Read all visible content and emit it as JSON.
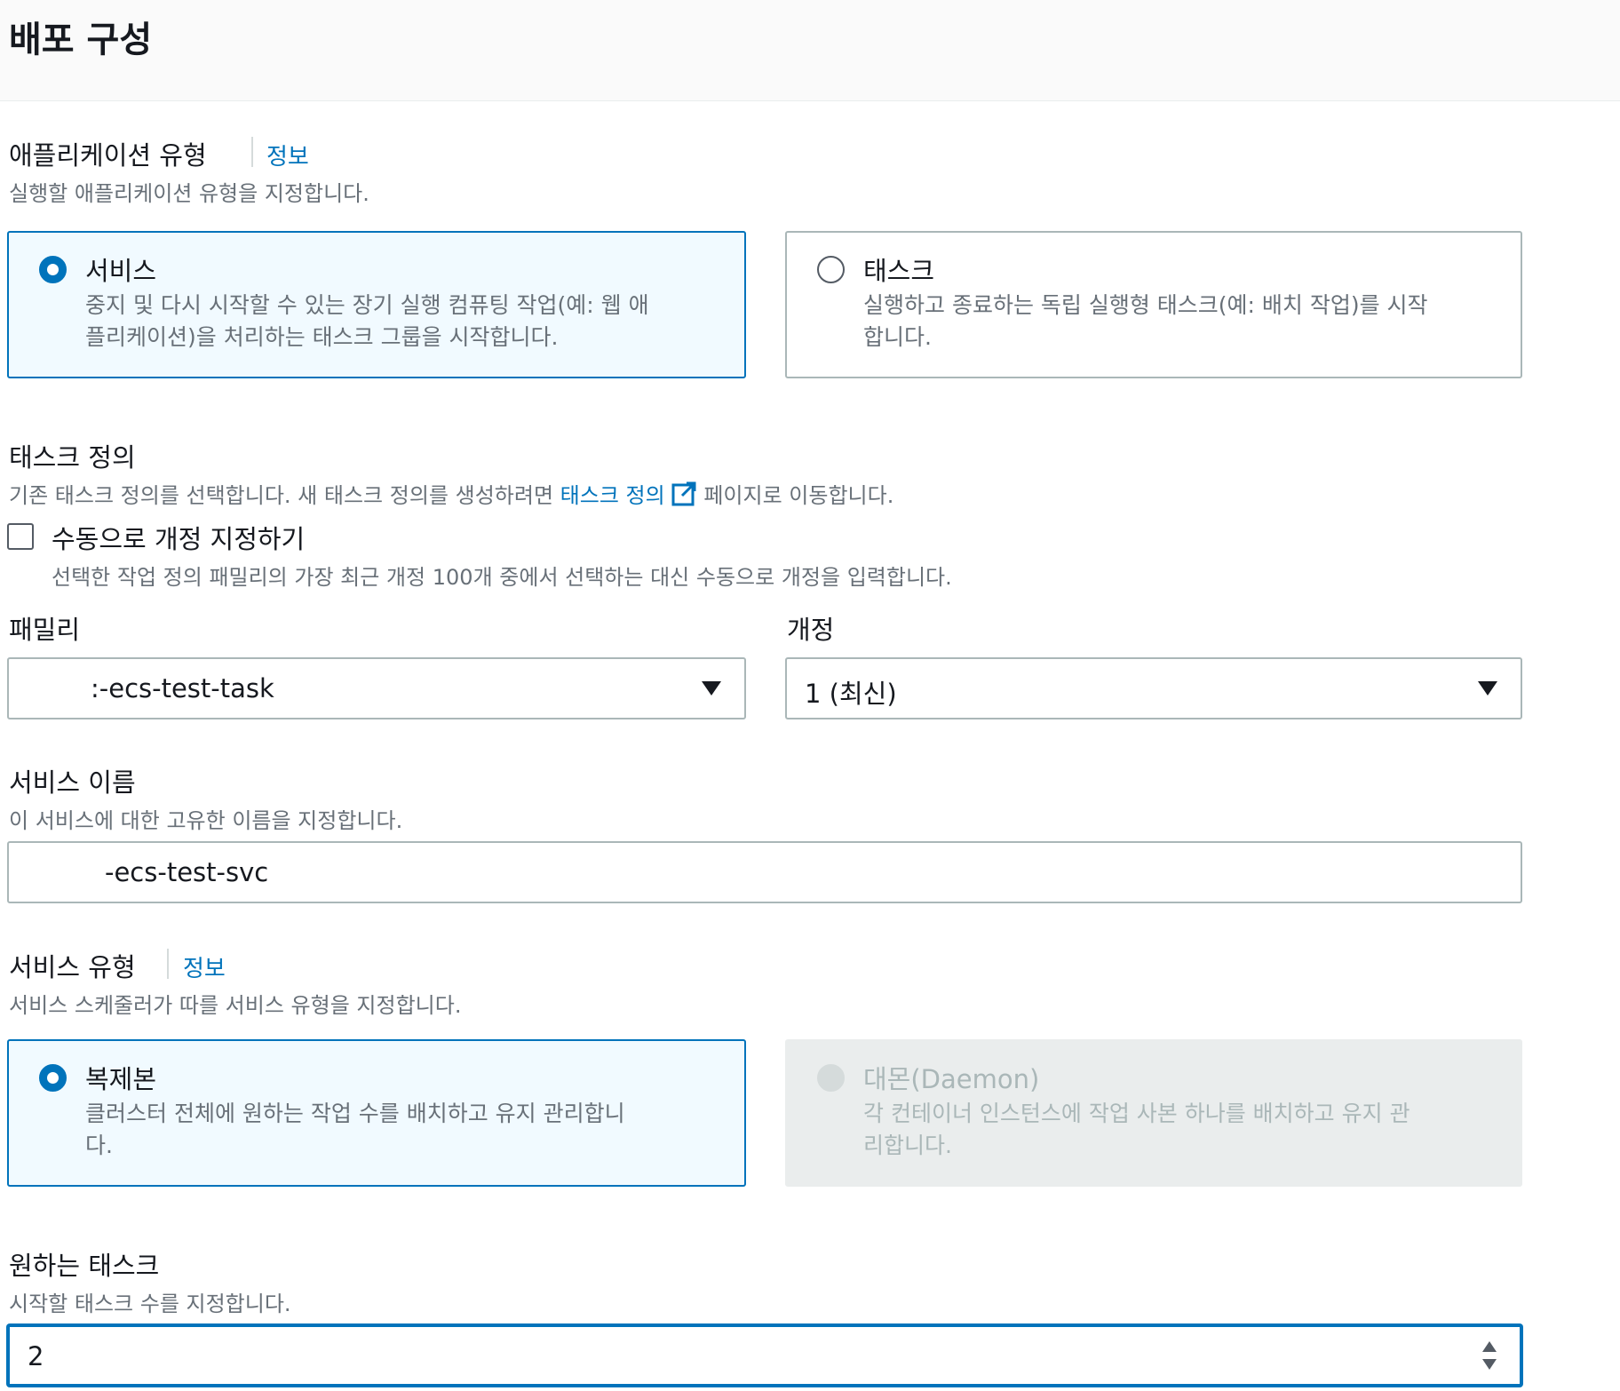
{
  "header": {
    "title": "배포 구성"
  },
  "application_type": {
    "label": "애플리케이션 유형",
    "info_link": "정보",
    "description": "실행할 애플리케이션 유형을 지정합니다.",
    "options": [
      {
        "title": "서비스",
        "description_line1": "중지 및 다시 시작할 수 있는 장기 실행 컴퓨팅 작업(예: 웹 애",
        "description_line2": "플리케이션)을 처리하는 태스크 그룹을 시작합니다.",
        "selected": true
      },
      {
        "title": "태스크",
        "description_line1": "실행하고 종료하는 독립 실행형 태스크(예: 배치 작업)를 시작",
        "description_line2": "합니다.",
        "selected": false
      }
    ]
  },
  "task_definition": {
    "label": "태스크 정의",
    "description_prefix": "기존 태스크 정의를 선택합니다. 새 태스크 정의를 생성하려면",
    "description_link": "태스크 정의",
    "description_suffix": "페이지로 이동합니다.",
    "manual_revision": {
      "label": "수동으로 개정 지정하기",
      "description": "선택한 작업 정의 패밀리의 가장 최근 개정 100개 중에서 선택하는 대신 수동으로 개정을 입력합니다.",
      "checked": false
    },
    "family": {
      "label": "패밀리",
      "value": ":-ecs-test-task"
    },
    "revision": {
      "label": "개정",
      "value": "1 (최신)"
    }
  },
  "service_name": {
    "label": "서비스 이름",
    "description": "이 서비스에 대한 고유한 이름을 지정합니다.",
    "value": "-ecs-test-svc"
  },
  "service_type": {
    "label": "서비스 유형",
    "info_link": "정보",
    "description": "서비스 스케줄러가 따를 서비스 유형을 지정합니다.",
    "options": [
      {
        "title": "복제본",
        "description_line1": "클러스터 전체에 원하는 작업 수를 배치하고 유지 관리합니",
        "description_line2": "다.",
        "selected": true,
        "disabled": false
      },
      {
        "title": "대몬(Daemon)",
        "description_line1": "각 컨테이너 인스턴스에 작업 사본 하나를 배치하고 유지 관",
        "description_line2": "리합니다.",
        "selected": false,
        "disabled": true
      }
    ]
  },
  "desired_tasks": {
    "label": "원하는 태스크",
    "description": "시작할 태스크 수를 지정합니다.",
    "value": "2"
  },
  "colors": {
    "accent": "#0073bb",
    "text": "#16191f",
    "muted": "#687078",
    "border": "#aab7b8"
  },
  "icons": {
    "external_link": "external-link-icon",
    "select_caret": "caret-down-icon",
    "stepper": "stepper-icon"
  }
}
